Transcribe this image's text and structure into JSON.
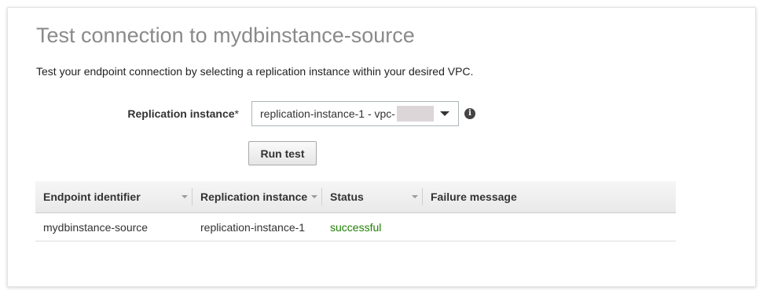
{
  "panel": {
    "title": "Test connection to mydbinstance-source",
    "description": "Test your endpoint connection by selecting a replication instance within your desired VPC."
  },
  "form": {
    "label": "Replication instance",
    "required_marker": "*",
    "select_value": "replication-instance-1 - vpc-",
    "info_icon": "info-icon",
    "run_test_label": "Run test"
  },
  "table": {
    "columns": [
      "Endpoint identifier",
      "Replication instance",
      "Status",
      "Failure message"
    ],
    "rows": [
      {
        "endpoint_identifier": "mydbinstance-source",
        "replication_instance": "replication-instance-1",
        "status": "successful",
        "failure_message": ""
      }
    ]
  },
  "colors": {
    "status_success": "#1d8102",
    "title_gray": "#8a8a8a"
  }
}
